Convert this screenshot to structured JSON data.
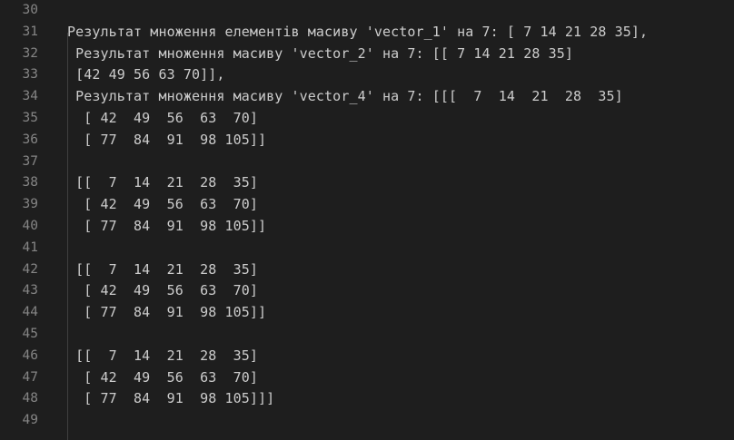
{
  "editor": {
    "lines": [
      {
        "num": "30",
        "text": ""
      },
      {
        "num": "31",
        "text": "Результат множення елементів масиву 'vector_1' на 7: [ 7 14 21 28 35],"
      },
      {
        "num": "32",
        "text": " Результат множення масиву 'vector_2' на 7: [[ 7 14 21 28 35]"
      },
      {
        "num": "33",
        "text": " [42 49 56 63 70]],"
      },
      {
        "num": "34",
        "text": " Результат множення масиву 'vector_4' на 7: [[[  7  14  21  28  35]"
      },
      {
        "num": "35",
        "text": "  [ 42  49  56  63  70]"
      },
      {
        "num": "36",
        "text": "  [ 77  84  91  98 105]]"
      },
      {
        "num": "37",
        "text": ""
      },
      {
        "num": "38",
        "text": " [[  7  14  21  28  35]"
      },
      {
        "num": "39",
        "text": "  [ 42  49  56  63  70]"
      },
      {
        "num": "40",
        "text": "  [ 77  84  91  98 105]]"
      },
      {
        "num": "41",
        "text": ""
      },
      {
        "num": "42",
        "text": " [[  7  14  21  28  35]"
      },
      {
        "num": "43",
        "text": "  [ 42  49  56  63  70]"
      },
      {
        "num": "44",
        "text": "  [ 77  84  91  98 105]]"
      },
      {
        "num": "45",
        "text": ""
      },
      {
        "num": "46",
        "text": " [[  7  14  21  28  35]"
      },
      {
        "num": "47",
        "text": "  [ 42  49  56  63  70]"
      },
      {
        "num": "48",
        "text": "  [ 77  84  91  98 105]]]"
      },
      {
        "num": "49",
        "text": ""
      }
    ]
  },
  "colors": {
    "background": "#1e1e1e",
    "line_number": "#858585",
    "text": "#cccccc",
    "indent_guide": "#404040"
  }
}
